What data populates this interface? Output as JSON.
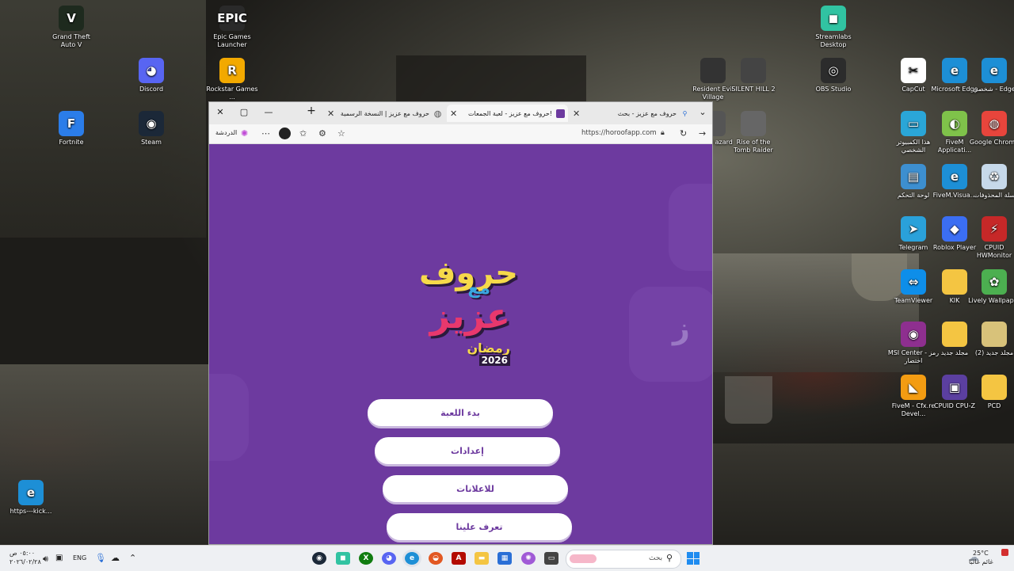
{
  "desktop_icons": [
    {
      "label": "Grand Theft Auto V",
      "icon": "gta-v-icon",
      "glyph": "V",
      "color": "#1e2a1e"
    },
    {
      "label": "Epic Games Launcher",
      "icon": "epic-games-icon",
      "glyph": "EPIC",
      "color": "#2a2a2a"
    },
    {
      "label": "Streamlabs Desktop",
      "icon": "streamlabs-icon",
      "glyph": "◼",
      "color": "#31c3a2"
    },
    {
      "label": "Discord",
      "icon": "discord-icon",
      "glyph": "◕",
      "color": "#5865f2"
    },
    {
      "label": "Rockstar Games ...",
      "icon": "rockstar-icon",
      "glyph": "R",
      "color": "#f2a900"
    },
    {
      "label": "Resident Evil Village",
      "icon": "re-village-icon",
      "glyph": "",
      "color": "#333"
    },
    {
      "label": "SILENT HILL 2",
      "icon": "silent-hill-icon",
      "glyph": "",
      "color": "#444"
    },
    {
      "label": "OBS Studio",
      "icon": "obs-icon",
      "glyph": "◎",
      "color": "#2c2c2c"
    },
    {
      "label": "CapCut",
      "icon": "capcut-icon",
      "glyph": "✂",
      "color": "#fff"
    },
    {
      "label": "Microsoft Edge",
      "icon": "edge-icon",
      "glyph": "e",
      "color": "#1d8fd6"
    },
    {
      "label": "شخصي - Edge",
      "icon": "edge-profile-icon",
      "glyph": "e",
      "color": "#1d8fd6"
    },
    {
      "label": "Fortnite",
      "icon": "fortnite-icon",
      "glyph": "F",
      "color": "#2b7de9"
    },
    {
      "label": "Steam",
      "icon": "steam-icon",
      "glyph": "◉",
      "color": "#1b2838"
    },
    {
      "label": "nt Evil azard",
      "icon": "re-biohazard-icon",
      "glyph": "",
      "color": "#555"
    },
    {
      "label": "Rise of the Tomb Raider",
      "icon": "tomb-raider-icon",
      "glyph": "",
      "color": "#666"
    },
    {
      "label": "هذا الكمبيوتر الشخصي",
      "icon": "this-pc-icon",
      "glyph": "▭",
      "color": "#2aa6d8"
    },
    {
      "label": "FiveM Applicati...",
      "icon": "fivem-app-icon",
      "glyph": "◐",
      "color": "#7fc24a"
    },
    {
      "label": "Google Chrome",
      "icon": "chrome-icon",
      "glyph": "◍",
      "color": "#e8453c"
    },
    {
      "label": "لوحة التحكم",
      "icon": "control-panel-icon",
      "glyph": "▤",
      "color": "#3d8fd0"
    },
    {
      "label": "FiveM.Visua...",
      "icon": "fivem-visual-icon",
      "glyph": "e",
      "color": "#1d8fd6"
    },
    {
      "label": "سلة المحذوفات",
      "icon": "recycle-bin-icon",
      "glyph": "♻",
      "color": "#c7d9ea"
    },
    {
      "label": "Telegram",
      "icon": "telegram-icon",
      "glyph": "➤",
      "color": "#2aa1da"
    },
    {
      "label": "Roblox Player",
      "icon": "roblox-icon",
      "glyph": "◆",
      "color": "#3b6ef3"
    },
    {
      "label": "CPUID HWMonitor",
      "icon": "hwmonitor-icon",
      "glyph": "⚡",
      "color": "#c62828"
    },
    {
      "label": "TeamViewer",
      "icon": "teamviewer-icon",
      "glyph": "⇔",
      "color": "#0e8ee9"
    },
    {
      "label": "KIK",
      "icon": "folder-kik-icon",
      "glyph": "",
      "color": "#f4c542"
    },
    {
      "label": "Lively Wallpaper",
      "icon": "lively-icon",
      "glyph": "✿",
      "color": "#4caf50"
    },
    {
      "label": "MSI Center - رمز اختصار",
      "icon": "msi-center-icon",
      "glyph": "◉",
      "color": "#8e2f8f"
    },
    {
      "label": "مجلد جديد",
      "icon": "folder-new-icon",
      "glyph": "",
      "color": "#f4c542"
    },
    {
      "label": "مجلد جديد (2)",
      "icon": "folder-new2-icon",
      "glyph": "",
      "color": "#d8c27a"
    },
    {
      "label": "FiveM - Cfx.re Devel...",
      "icon": "fivem-cfx-icon",
      "glyph": "◣",
      "color": "#f39c12"
    },
    {
      "label": "CPUID CPU-Z",
      "icon": "cpuz-icon",
      "glyph": "▣",
      "color": "#5b3fa0"
    },
    {
      "label": "PCD",
      "icon": "folder-pcd-icon",
      "glyph": "",
      "color": "#f4c542"
    },
    {
      "label": "https---kick...",
      "icon": "edge-kick-icon",
      "glyph": "e",
      "color": "#1d8fd6"
    }
  ],
  "browser": {
    "tabs": [
      {
        "label": "حروف مع عزيز - بحث",
        "icon": "search-favicon-icon",
        "active": false
      },
      {
        "label": "حروف مع عزيز - لعبة الجمعات!",
        "icon": "horoof-favicon-icon",
        "active": true
      },
      {
        "label": "حروف مع عزيز | النسخة الرسمية",
        "icon": "globe-favicon-icon",
        "active": false
      }
    ],
    "new_tab_label": "+",
    "url": "https://horoofapp.com",
    "chat_label": "الدردشة",
    "logo": {
      "line1": "حروف",
      "line2": "مع",
      "line3": "عزيز",
      "line4": "رمضان",
      "line5": "2026"
    },
    "menu": [
      "بدء اللعبة",
      "إعدادات",
      "للاعلانات",
      "تعرف علينا"
    ]
  },
  "taskbar": {
    "search_placeholder": "بحث",
    "weather_temp": "25°C",
    "weather_desc": "غائم غالبًا",
    "lang": "ENG",
    "time": "٠٥:٠٠ ص",
    "date": "٢٠٢٦/٠٢/٢٨",
    "apps": [
      "steam-taskbar-icon",
      "streamlabs-taskbar-icon",
      "xbox-taskbar-icon",
      "discord-taskbar-icon",
      "edge-taskbar-icon",
      "brave-taskbar-icon",
      "adobe-taskbar-icon",
      "file-explorer-taskbar-icon",
      "store-taskbar-icon",
      "copilot-taskbar-icon",
      "window-taskbar-icon"
    ]
  },
  "colors": {
    "site_purple": "#6d3a9f",
    "logo_yellow": "#f6d94a",
    "logo_pink": "#e8386d",
    "logo_blue": "#3aa7e0"
  }
}
